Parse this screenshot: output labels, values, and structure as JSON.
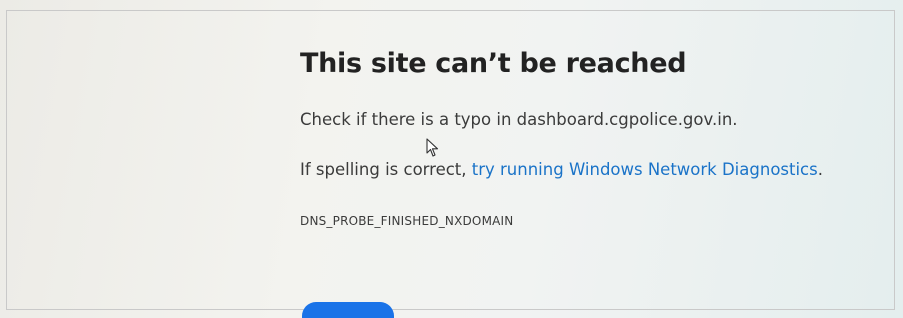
{
  "error_page": {
    "title": "This site can’t be reached",
    "message_prefix": "Check if there is a typo in ",
    "domain": "dashboard.cgpolice.gov.in",
    "message_suffix": ".",
    "spelling_prefix": "If spelling is correct, ",
    "diagnostics_link": "try running Windows Network Diagnostics",
    "spelling_suffix": ".",
    "error_code": "DNS_PROBE_FINISHED_NXDOMAIN"
  },
  "colors": {
    "link": "#1a73c8",
    "button": "#1a73e8",
    "title": "#222222",
    "text": "#3b3b3b"
  },
  "icons": {
    "cursor": "mouse-pointer-icon"
  }
}
